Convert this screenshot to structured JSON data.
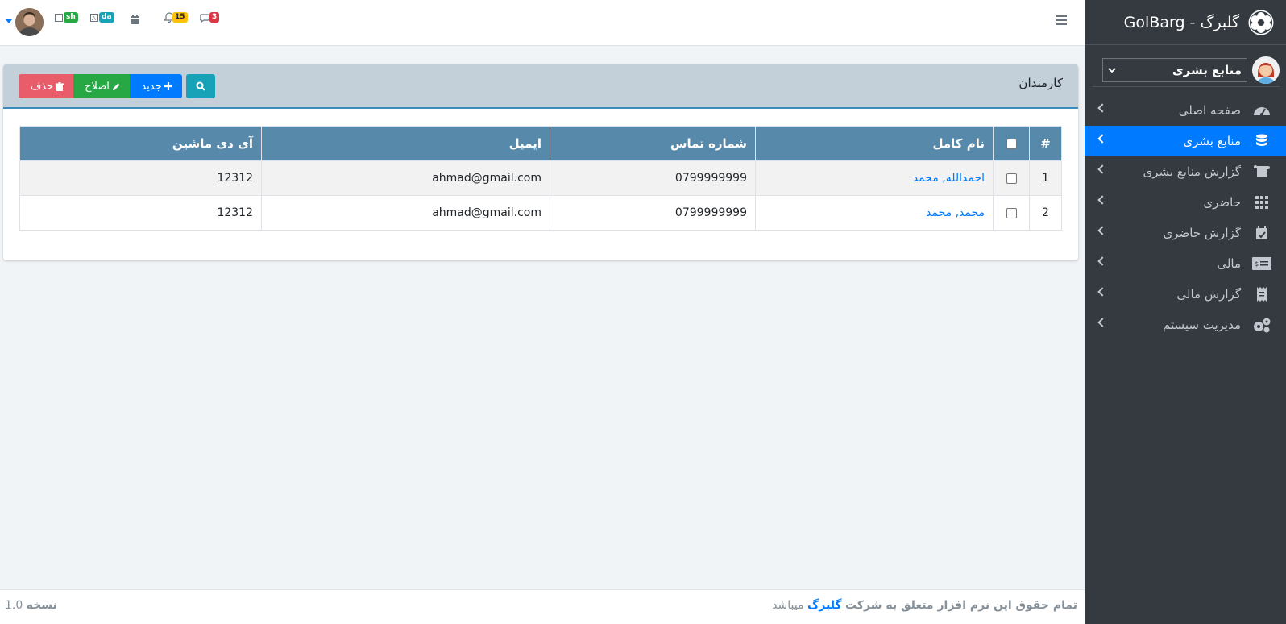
{
  "brand": {
    "title": "GolBarg - گلبرگ"
  },
  "sidebar": {
    "department": "منابع بشری",
    "items": [
      {
        "label": "صفحه اصلی",
        "icon": "dashboard-icon"
      },
      {
        "label": "منابع بشری",
        "icon": "database-icon"
      },
      {
        "label": "گزارش منابع بشری",
        "icon": "scroll-icon"
      },
      {
        "label": "حاضری",
        "icon": "grid-icon"
      },
      {
        "label": "گزارش حاضری",
        "icon": "calendar-check-icon"
      },
      {
        "label": "مالی",
        "icon": "money-icon"
      },
      {
        "label": "گزارش مالی",
        "icon": "receipt-icon"
      },
      {
        "label": "مدیریت سیستم",
        "icon": "cogs-icon"
      }
    ],
    "active_index": 1
  },
  "topbar": {
    "messages_count": "3",
    "notifications_count": "15",
    "lang_da": "da",
    "lang_sh": "sh"
  },
  "card": {
    "title": "کارمندان",
    "buttons": {
      "new": "جدید",
      "edit": "اصلاح",
      "delete": "حذف"
    }
  },
  "table": {
    "headers": {
      "num": "#",
      "name": "نام کامل",
      "phone": "شماره تماس",
      "email": "ایمیل",
      "machine": "آی دی ماشین"
    },
    "rows": [
      {
        "num": "1",
        "name": "احمدالله, محمد",
        "phone": "0799999999",
        "email": "ahmad@gmail.com",
        "machine": "12312"
      },
      {
        "num": "2",
        "name": "محمد, محمد",
        "phone": "0799999999",
        "email": "ahmad@gmail.com",
        "machine": "12312"
      }
    ]
  },
  "footer": {
    "text_before": "تمام حقوق این نرم افزار متعلق به شرکت",
    "company": "گلبرگ",
    "text_after": "میباشد",
    "version_label": "نسخه",
    "version": "1.0"
  },
  "colors": {
    "sidebar_bg": "#343a40",
    "active": "#007bff",
    "table_header": "#5789ab",
    "card_header": "#c3cfd9"
  }
}
